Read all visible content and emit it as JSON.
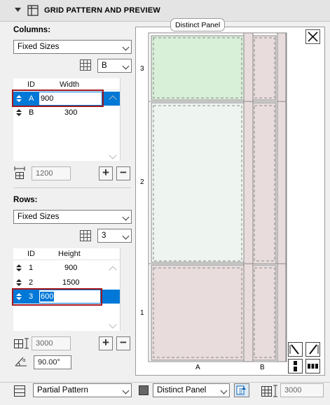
{
  "header": {
    "title": "GRID PATTERN AND PREVIEW"
  },
  "columns": {
    "label": "Columns:",
    "mode": "Fixed Sizes",
    "selected_id": "B",
    "table_headers": {
      "id": "ID",
      "width": "Width"
    },
    "rows": [
      {
        "id": "A",
        "value": "900"
      },
      {
        "id": "B",
        "value": "300"
      }
    ],
    "total": "1200"
  },
  "rows": {
    "label": "Rows:",
    "mode": "Fixed Sizes",
    "count": "3",
    "table_headers": {
      "id": "ID",
      "height": "Height"
    },
    "rows": [
      {
        "id": "1",
        "value": "900"
      },
      {
        "id": "2",
        "value": "1500"
      },
      {
        "id": "3",
        "value": "600"
      }
    ],
    "total": "3000",
    "angle": "90.00°"
  },
  "preview": {
    "tooltip": "Distinct Panel",
    "row_labels": [
      "3",
      "2",
      "1"
    ],
    "col_labels": [
      "A",
      "B"
    ],
    "colors": {
      "panel": "#e8dcdc",
      "selected": "#d8efd8",
      "distinct": "#eef4ef",
      "line": "#8a8a8a"
    }
  },
  "footer": {
    "pattern": "Partial Pattern",
    "panel": "Distinct Panel",
    "height": "3000"
  }
}
